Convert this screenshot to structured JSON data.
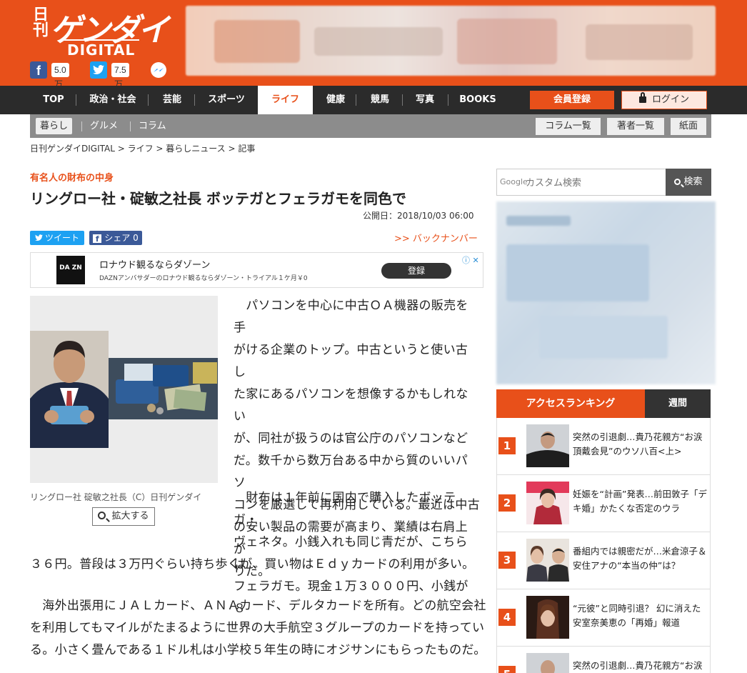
{
  "header": {
    "logo_nikkan": "日刊",
    "logo_gendai": "ゲンダイ",
    "logo_digital": "DIGITAL",
    "facebook_count": "5.0万",
    "twitter_count": "7.5万"
  },
  "nav": {
    "items": [
      "TOP",
      "政治・社会",
      "芸能",
      "スポーツ",
      "ライフ",
      "健康",
      "競馬",
      "写真",
      "BOOKS"
    ],
    "active": "ライフ",
    "register_label": "会員登録",
    "login_label": "ログイン"
  },
  "subnav": {
    "items": [
      "暮らし",
      "グルメ",
      "コラム"
    ],
    "buttons": [
      "コラム一覧",
      "著者一覧",
      "紙面"
    ]
  },
  "breadcrumb": "日刊ゲンダイDIGITAL > ライフ > 暮らしニュース > 記事",
  "article": {
    "category": "有名人の財布の中身",
    "title": "リングロー社・碇敏之社長 ボッテガとフェラガモを同色で",
    "date": "公開日：2018/10/03 06:00",
    "tweet_label": "ツイート",
    "share_label": "シェア 0",
    "backnumber": ">> バックナンバー",
    "caption": "リングロー社 碇敏之社長（C）日刊ゲンダイ",
    "zoom_label": "拡大する",
    "para1_lines": [
      "　パソコンを中心に中古ＯＡ機器の販売を手",
      "がける企業のトップ。中古というと使い古し",
      "た家にあるパソコンを想像するかもしれない",
      "が、同社が扱うのは官公庁のパソコンなど",
      "だ。数千から数万台ある中から質のいいパソ",
      "コンを厳選して再利用している。最近は中古",
      "の安い製品の需要が高まり、業績は右肩上が",
      "りだ。"
    ],
    "para2_lines": [
      "　財布は１年前に国内で購入したボッテガ・",
      "ヴェネタ。小銭入れも同じ青だが、こちらは",
      "フェラガモ。現金１万３０００円、小銭が８"
    ],
    "para2_full_lines": [
      "３６円。普段は３万円ぐらい持ち歩くが、買い物はＥｄｙカードの利用が多い。"
    ],
    "para3_lines": [
      "　海外出張用にＪＡＬカード、ＡＮＡカード、デルタカードを所有。どの航空会社",
      "を利用してもマイルがたまるように世界の大手航空３グループのカードを持ってい",
      "る。小さく畳んである１ドル札は小学校５年生の時にオジサンにもらったものだ。"
    ]
  },
  "inline_ad": {
    "logo": "DA ZN",
    "title": "ロナウド観るならダゾーン",
    "subtitle": "DAZNアンバサダーのロナウド観るならダゾーン・トライアル１ケ月￥0",
    "cta": "登録"
  },
  "sidebar": {
    "search_brand": "Google",
    "search_placeholder": "カスタム検索",
    "search_button": "検索",
    "ranking_tab": "アクセスランキング",
    "weekly_tab": "週間",
    "ranking": [
      {
        "rank": "1",
        "text": "突然の引退劇…貴乃花親方“お涙頂戴会見”のウソ八百<上>"
      },
      {
        "rank": "2",
        "text": "妊娠を“計画”発表…前田敦子「デキ婚」かたくな否定のウラ"
      },
      {
        "rank": "3",
        "text": "番組内では親密だが…米倉涼子＆安住アナの“本当の仲”は？"
      },
      {
        "rank": "4",
        "text": "“元彼”と同時引退？ 幻に消えた安室奈美恵の「再婚」報道"
      },
      {
        "rank": "5",
        "text": "突然の引退劇…貴乃花親方“お涙"
      }
    ]
  },
  "colors": {
    "brand": "#e8501a",
    "nav_bg": "#2b2b2b",
    "subnav_bg": "#8c8c8c"
  }
}
